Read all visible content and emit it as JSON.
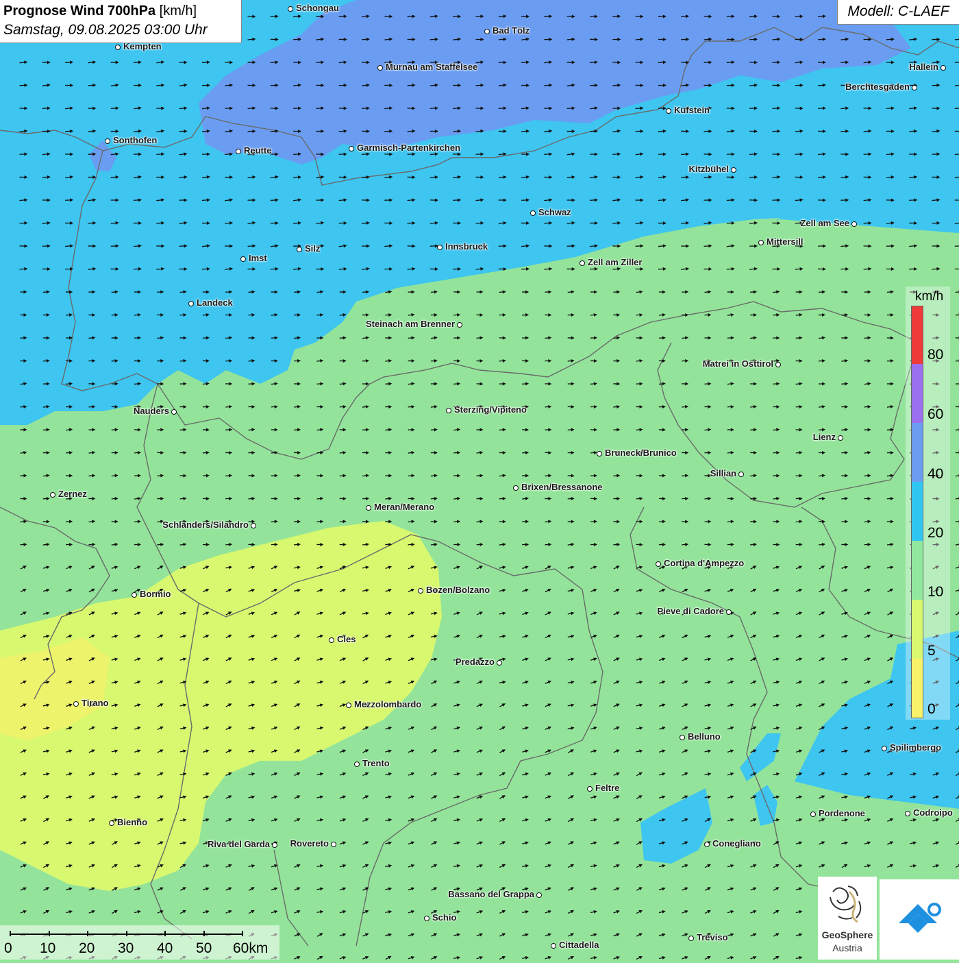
{
  "header": {
    "title_bold": "Prognose Wind 700hPa",
    "title_unit": "[km/h]",
    "date": "Samstag, 09.08.2025 03:00 Uhr",
    "model": "Modell: C-LAEF"
  },
  "legend": {
    "unit": "km/h",
    "ticks": [
      "80",
      "60",
      "40",
      "20",
      "10",
      "5",
      "0"
    ],
    "colors": [
      "#ef3a3a",
      "#9a6ff0",
      "#6a9df2",
      "#30c6f2",
      "#90e89e",
      "#d8f870",
      "#f6f26a"
    ]
  },
  "map_colors": {
    "band_0_5": "#f6f26a",
    "band_5_10": "#d8f870",
    "band_10_20": "#93e49a",
    "band_20_40": "#3ec5f0",
    "band_40_60": "#6a9df2",
    "border": "#6a6a6a"
  },
  "cities": [
    {
      "name": "Schongau"
    },
    {
      "name": "Bad Tölz"
    },
    {
      "name": "Kempten"
    },
    {
      "name": "Murnau am Staffelsee"
    },
    {
      "name": "Hallein"
    },
    {
      "name": "Berchtesgaden"
    },
    {
      "name": "Kufstein"
    },
    {
      "name": "Sonthofen"
    },
    {
      "name": "Reutte"
    },
    {
      "name": "Garmisch-Partenkirchen"
    },
    {
      "name": "Kitzbühel"
    },
    {
      "name": "Schwaz"
    },
    {
      "name": "Zell am See"
    },
    {
      "name": "Mittersill"
    },
    {
      "name": "Imst"
    },
    {
      "name": "Silz"
    },
    {
      "name": "Innsbruck"
    },
    {
      "name": "Zell am Ziller"
    },
    {
      "name": "Landeck"
    },
    {
      "name": "Steinach am Brenner"
    },
    {
      "name": "Matrei in Osttirol"
    },
    {
      "name": "Nauders"
    },
    {
      "name": "Sterzing/Vipiteno"
    },
    {
      "name": "Lienz"
    },
    {
      "name": "Bruneck/Brunico"
    },
    {
      "name": "Sillian"
    },
    {
      "name": "Brixen/Bressanone"
    },
    {
      "name": "Zernez"
    },
    {
      "name": "Meran/Merano"
    },
    {
      "name": "Schlanders/Silandro"
    },
    {
      "name": "Cortina d'Ampezzo"
    },
    {
      "name": "Bozen/Bolzano"
    },
    {
      "name": "Bormio"
    },
    {
      "name": "Pieve di Cadore"
    },
    {
      "name": "Cles"
    },
    {
      "name": "Predazzo"
    },
    {
      "name": "Tirano"
    },
    {
      "name": "Mezzolombardo"
    },
    {
      "name": "Belluno"
    },
    {
      "name": "Spilimbergo"
    },
    {
      "name": "Trento"
    },
    {
      "name": "Feltre"
    },
    {
      "name": "Pordenone"
    },
    {
      "name": "Codroipo"
    },
    {
      "name": "Bienno"
    },
    {
      "name": "Riva del Garda"
    },
    {
      "name": "Rovereto"
    },
    {
      "name": "Conegliano"
    },
    {
      "name": "Bassano del Grappa"
    },
    {
      "name": "Schio"
    },
    {
      "name": "Treviso"
    },
    {
      "name": "Cittadella"
    }
  ],
  "scale": {
    "labels": [
      "0",
      "10",
      "20",
      "30",
      "40",
      "50",
      "60km"
    ]
  },
  "logos": {
    "geosphere_line1": "GeoSphere",
    "geosphere_line2": "Austria"
  }
}
